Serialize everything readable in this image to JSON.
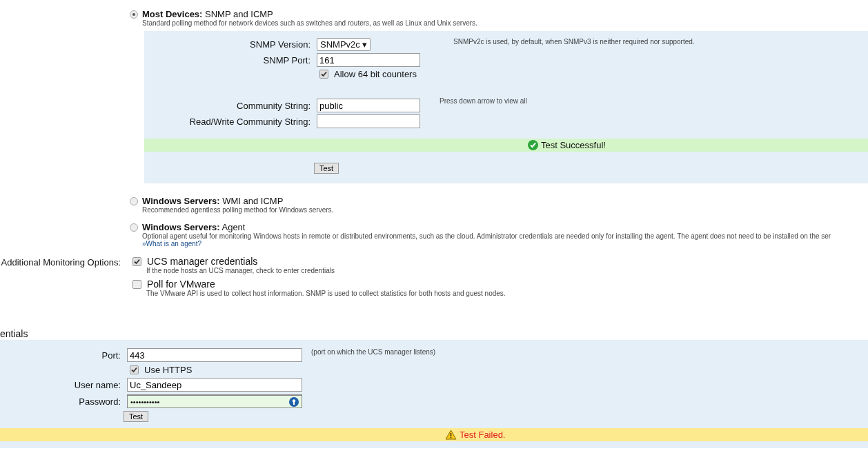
{
  "polling_methods": [
    {
      "title_bold": "Most Devices:",
      "title_rest": "SNMP and ICMP",
      "description": "Standard polling method for network devices such as switches and routers, as well as Linux and Unix servers.",
      "selected": true
    },
    {
      "title_bold": "Windows Servers:",
      "title_rest": "WMI and ICMP",
      "description": "Recommended agentless polling method for Windows servers.",
      "selected": false
    },
    {
      "title_bold": "Windows Servers:",
      "title_rest": "Agent",
      "description": "Optional agent useful for monitoring Windows hosts in remote or distributed environments, such as the cloud. Administrator credentials are needed only for installing the agent. The agent does not need to be installed on the ser",
      "link": "»What is an agent?",
      "selected": false
    }
  ],
  "snmp_panel": {
    "version_label": "SNMP Version:",
    "version_value": "SNMPv2c ▾",
    "version_note": "SNMPv2c is used, by default, when SNMPv3 is neither required nor supported.",
    "port_label": "SNMP Port:",
    "port_value": "161",
    "counters": {
      "label": "Allow 64 bit counters",
      "checked": true
    },
    "community_label": "Community String:",
    "community_value": "public",
    "community_note": "Press down arrow to view all",
    "rw_label": "Read/Write Community String:",
    "status": {
      "kind": "success",
      "text": "Test Successful!"
    },
    "test_button": "Test"
  },
  "additional_options": {
    "label": "Additional Monitoring Options:",
    "items": [
      {
        "label": "UCS manager credentials",
        "description": "If the node hosts an UCS manager, check to enter credentials",
        "checked": true
      },
      {
        "label": "Poll for VMware",
        "description": "The VMware API is used to collect host information. SNMP is used to collect statistics for both hosts and guest nodes.",
        "checked": false
      }
    ]
  },
  "credentials": {
    "heading": "entials",
    "port_label": "Port:",
    "port_value": "443",
    "port_note": "(port on which the UCS manager listens)",
    "https": {
      "label": "Use HTTPS",
      "checked": true
    },
    "user_label": "User name:",
    "user_value": "Uc_Sandeep",
    "password_label": "Password:",
    "password_value": "•••••••••••",
    "test_button": "Test",
    "status": {
      "kind": "failure",
      "text": "Test Failed."
    }
  }
}
